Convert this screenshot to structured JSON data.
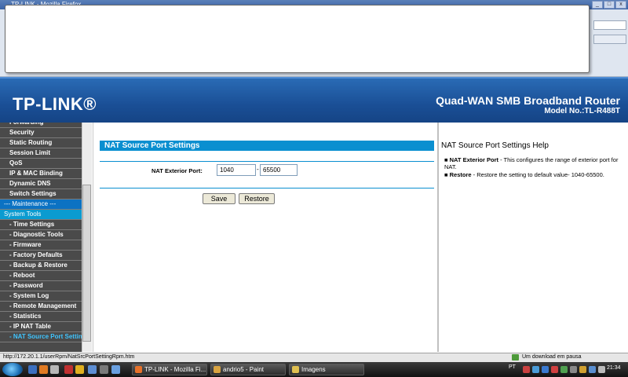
{
  "browser": {
    "title": "TP-LINK - Mozilla Firefox",
    "window_buttons": [
      "_",
      "□",
      "x"
    ]
  },
  "header": {
    "logo": "TP-LINK®",
    "product": "Quad-WAN SMB Broadband Router",
    "model": "Model No.:TL-R488T"
  },
  "menu": {
    "items": [
      {
        "label": "Forwarding",
        "type": "item"
      },
      {
        "label": "Security",
        "type": "item"
      },
      {
        "label": "Static Routing",
        "type": "item"
      },
      {
        "label": "Session Limit",
        "type": "item"
      },
      {
        "label": "QoS",
        "type": "item"
      },
      {
        "label": "IP & MAC Binding",
        "type": "item"
      },
      {
        "label": "Dynamic DNS",
        "type": "item"
      },
      {
        "label": "Switch Settings",
        "type": "item"
      },
      {
        "label": "--- Maintenance ---",
        "type": "section"
      },
      {
        "label": "System Tools",
        "type": "highlight"
      },
      {
        "label": "- Time Settings",
        "type": "item"
      },
      {
        "label": "- Diagnostic Tools",
        "type": "item"
      },
      {
        "label": "- Firmware",
        "type": "item"
      },
      {
        "label": "- Factory Defaults",
        "type": "item"
      },
      {
        "label": "- Backup & Restore",
        "type": "item"
      },
      {
        "label": "- Reboot",
        "type": "item"
      },
      {
        "label": "- Password",
        "type": "item"
      },
      {
        "label": "- System Log",
        "type": "item"
      },
      {
        "label": "- Remote Management",
        "type": "item"
      },
      {
        "label": "- Statistics",
        "type": "item"
      },
      {
        "label": "- IP NAT Table",
        "type": "item"
      },
      {
        "label": "- NAT Source Port Settings",
        "type": "active"
      }
    ]
  },
  "main": {
    "section_title": "NAT Source Port Settings",
    "field_label": "NAT Exterior Port:",
    "port_from": "1040",
    "port_separator": "-",
    "port_to": "65500",
    "save_label": "Save",
    "restore_label": "Restore"
  },
  "help": {
    "title": "NAT Source Port Settings Help",
    "items": [
      {
        "term": "NAT Exterior Port",
        "text": " - This configures the range of exterior port for NAT."
      },
      {
        "term": "Restore",
        "text": " - Restore the setting to default value- 1040-65500."
      }
    ]
  },
  "statusbar": {
    "url": "http://172.20.1.1/userRpm/NatSrcPortSettingRpm.htm",
    "download": "Um download em pausa"
  },
  "taskbar": {
    "tasks": [
      {
        "label": "TP-LINK - Mozilla Fi...",
        "color": "#e8722a"
      },
      {
        "label": "andrio5 - Paint",
        "color": "#d9a441"
      },
      {
        "label": "Imagens",
        "color": "#e0c050"
      }
    ],
    "language": "PT",
    "time": "21:34"
  }
}
